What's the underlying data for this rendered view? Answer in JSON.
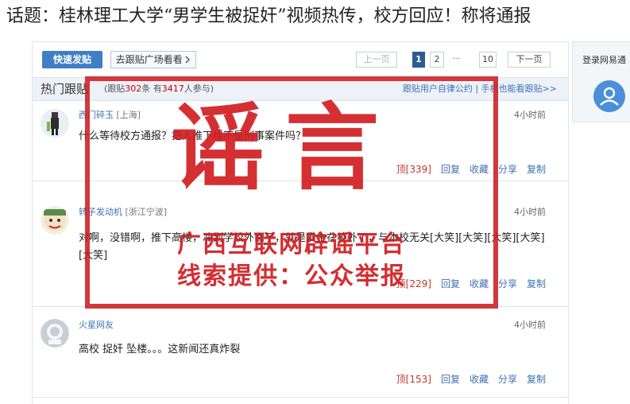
{
  "headline": "话题：桂林理工大学“男学生被捉奸”视频热传，校方回应！称将通报",
  "toolbar": {
    "post_button": "快速发贴",
    "plaza_button": "去跟贴广场看看",
    "plaza_icon": "chevron-right-icon",
    "prev": "上一页",
    "pages": [
      "1",
      "2",
      "10"
    ],
    "ellipsis": "···",
    "next": "下一页"
  },
  "hot": {
    "title": "热门跟贴",
    "count_prefix": "跟贴",
    "count": "302",
    "count_mid": "条 有",
    "people": "3417",
    "people_suffix": "人参与",
    "right_links": "跟贴用户自律公约 | 手机也能看跟贴>>"
  },
  "posts": [
    {
      "user": "西门碎玉",
      "location": "[上海]",
      "time": "4小时前",
      "text": "什么等待校方通报？把人推下楼不是刑事案件吗？",
      "likes": "顶[339]",
      "reply": "回复",
      "fav": "收藏",
      "share": "分享",
      "copy": "复制"
    },
    {
      "user": "转子发动机",
      "location": "[浙江宁波]",
      "time": "4小时前",
      "text": "对啊，没错啊，推下高楼，冲到学校外面了，就是发生在校外了，与本校无关[大笑][大笑][大笑][大笑][大笑]",
      "likes": "顶[229]",
      "reply": "回复",
      "fav": "收藏",
      "share": "分享",
      "copy": "复制"
    },
    {
      "user": "火星网友",
      "location": "",
      "time": "4小时前",
      "text": "高校 捉奸 坠楼。。。这新闻还真炸裂",
      "likes": "顶[153]",
      "reply": "回复",
      "fav": "收藏",
      "share": "分享",
      "copy": "复制"
    }
  ],
  "sidebar": {
    "login": "登录网易通"
  },
  "stamp": {
    "big": "谣言",
    "line1": "广西互联网辟谣平台",
    "line2": "线索提供：公众举报",
    "color": "#d01e22"
  },
  "colors": {
    "accent": "#3f7fc5",
    "link": "#3f72b0",
    "stamp": "#d01e22"
  }
}
